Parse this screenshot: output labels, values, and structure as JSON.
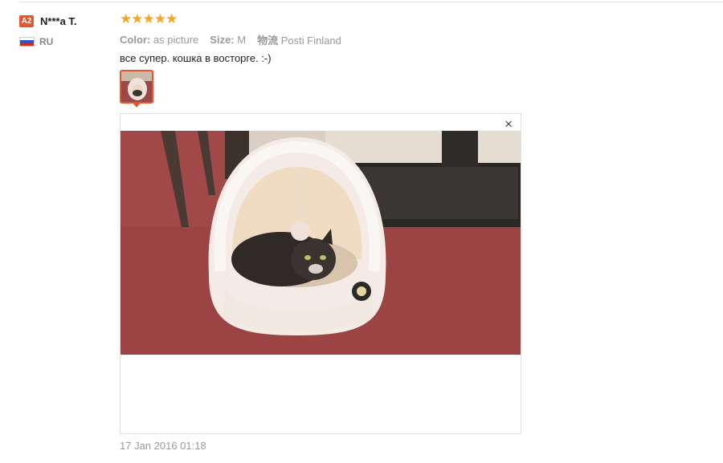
{
  "user": {
    "level_badge": "A2",
    "name": "N***a T.",
    "country_code": "RU",
    "flag_icon": "russia-flag-icon"
  },
  "review": {
    "rating": 5,
    "star_icon": "star-icon",
    "star_color": "#f5a623",
    "meta": {
      "color_label": "Color:",
      "color_value": "as picture",
      "size_label": "Size:",
      "size_value": "M",
      "shipping_label": "物流",
      "shipping_value": "Posti Finland"
    },
    "text": "все супер. кошка в восторге. :-)",
    "photo_thumbnail_icon": "cat-bed-photo",
    "viewer": {
      "close_label": "×",
      "photo": "cat-in-dome-bed-photo"
    },
    "date": "17 Jan 2016 01:18"
  },
  "colors": {
    "accent": "#e8542c",
    "muted_text": "#999999"
  }
}
